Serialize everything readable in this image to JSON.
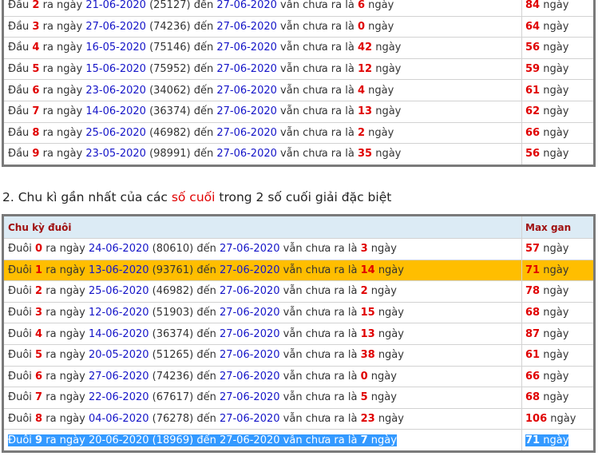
{
  "colors": {
    "date_blue": "#1515c8",
    "number_red": "#e00000",
    "highlight_row": "#ffbe00",
    "selection": "#3399ff",
    "header_bg": "#dcebf5"
  },
  "top_table": {
    "rows": [
      {
        "label": "Đầu",
        "digit": "2",
        "ra_ngay": "ra ngày",
        "date1": "21-06-2020",
        "code": "(25127)",
        "den": "đến",
        "date2": "27-06-2020",
        "mid": "vẫn chưa ra là",
        "count": "6",
        "unit": "ngày",
        "max": "84",
        "max_unit": "ngày"
      },
      {
        "label": "Đầu",
        "digit": "3",
        "ra_ngay": "ra ngày",
        "date1": "27-06-2020",
        "code": "(74236)",
        "den": "đến",
        "date2": "27-06-2020",
        "mid": "vẫn chưa ra là",
        "count": "0",
        "unit": "ngày",
        "max": "64",
        "max_unit": "ngày"
      },
      {
        "label": "Đầu",
        "digit": "4",
        "ra_ngay": "ra ngày",
        "date1": "16-05-2020",
        "code": "(75146)",
        "den": "đến",
        "date2": "27-06-2020",
        "mid": "vẫn chưa ra là",
        "count": "42",
        "unit": "ngày",
        "max": "56",
        "max_unit": "ngày"
      },
      {
        "label": "Đầu",
        "digit": "5",
        "ra_ngay": "ra ngày",
        "date1": "15-06-2020",
        "code": "(75952)",
        "den": "đến",
        "date2": "27-06-2020",
        "mid": "vẫn chưa ra là",
        "count": "12",
        "unit": "ngày",
        "max": "59",
        "max_unit": "ngày"
      },
      {
        "label": "Đầu",
        "digit": "6",
        "ra_ngay": "ra ngày",
        "date1": "23-06-2020",
        "code": "(34062)",
        "den": "đến",
        "date2": "27-06-2020",
        "mid": "vẫn chưa ra là",
        "count": "4",
        "unit": "ngày",
        "max": "61",
        "max_unit": "ngày"
      },
      {
        "label": "Đầu",
        "digit": "7",
        "ra_ngay": "ra ngày",
        "date1": "14-06-2020",
        "code": "(36374)",
        "den": "đến",
        "date2": "27-06-2020",
        "mid": "vẫn chưa ra là",
        "count": "13",
        "unit": "ngày",
        "max": "62",
        "max_unit": "ngày"
      },
      {
        "label": "Đầu",
        "digit": "8",
        "ra_ngay": "ra ngày",
        "date1": "25-06-2020",
        "code": "(46982)",
        "den": "đến",
        "date2": "27-06-2020",
        "mid": "vẫn chưa ra là",
        "count": "2",
        "unit": "ngày",
        "max": "66",
        "max_unit": "ngày"
      },
      {
        "label": "Đầu",
        "digit": "9",
        "ra_ngay": "ra ngày",
        "date1": "23-05-2020",
        "code": "(98991)",
        "den": "đến",
        "date2": "27-06-2020",
        "mid": "vẫn chưa ra là",
        "count": "35",
        "unit": "ngày",
        "max": "56",
        "max_unit": "ngày"
      }
    ]
  },
  "section2": {
    "heading_pre": "2. Chu kì gần nhất của các",
    "heading_accent": "số cuối",
    "heading_post": "trong 2 số cuối giải đặc biệt"
  },
  "bottom_table": {
    "header_col1": "Chu kỳ đuôi",
    "header_col2": "Max gan",
    "rows": [
      {
        "label": "Đuôi",
        "digit": "0",
        "ra_ngay": "ra ngày",
        "date1": "24-06-2020",
        "code": "(80610)",
        "den": "đến",
        "date2": "27-06-2020",
        "mid": "vẫn chưa ra là",
        "count": "3",
        "unit": "ngày",
        "max": "57",
        "max_unit": "ngày"
      },
      {
        "label": "Đuôi",
        "digit": "1",
        "ra_ngay": "ra ngày",
        "date1": "13-06-2020",
        "code": "(93761)",
        "den": "đến",
        "date2": "27-06-2020",
        "mid": "vẫn chưa ra là",
        "count": "14",
        "unit": "ngày",
        "max": "71",
        "max_unit": "ngày"
      },
      {
        "label": "Đuôi",
        "digit": "2",
        "ra_ngay": "ra ngày",
        "date1": "25-06-2020",
        "code": "(46982)",
        "den": "đến",
        "date2": "27-06-2020",
        "mid": "vẫn chưa ra là",
        "count": "2",
        "unit": "ngày",
        "max": "78",
        "max_unit": "ngày"
      },
      {
        "label": "Đuôi",
        "digit": "3",
        "ra_ngay": "ra ngày",
        "date1": "12-06-2020",
        "code": "(51903)",
        "den": "đến",
        "date2": "27-06-2020",
        "mid": "vẫn chưa ra là",
        "count": "15",
        "unit": "ngày",
        "max": "68",
        "max_unit": "ngày"
      },
      {
        "label": "Đuôi",
        "digit": "4",
        "ra_ngay": "ra ngày",
        "date1": "14-06-2020",
        "code": "(36374)",
        "den": "đến",
        "date2": "27-06-2020",
        "mid": "vẫn chưa ra là",
        "count": "13",
        "unit": "ngày",
        "max": "87",
        "max_unit": "ngày"
      },
      {
        "label": "Đuôi",
        "digit": "5",
        "ra_ngay": "ra ngày",
        "date1": "20-05-2020",
        "code": "(51265)",
        "den": "đến",
        "date2": "27-06-2020",
        "mid": "vẫn chưa ra là",
        "count": "38",
        "unit": "ngày",
        "max": "61",
        "max_unit": "ngày"
      },
      {
        "label": "Đuôi",
        "digit": "6",
        "ra_ngay": "ra ngày",
        "date1": "27-06-2020",
        "code": "(74236)",
        "den": "đến",
        "date2": "27-06-2020",
        "mid": "vẫn chưa ra là",
        "count": "0",
        "unit": "ngày",
        "max": "66",
        "max_unit": "ngày"
      },
      {
        "label": "Đuôi",
        "digit": "7",
        "ra_ngay": "ra ngày",
        "date1": "22-06-2020",
        "code": "(67617)",
        "den": "đến",
        "date2": "27-06-2020",
        "mid": "vẫn chưa ra là",
        "count": "5",
        "unit": "ngày",
        "max": "68",
        "max_unit": "ngày"
      },
      {
        "label": "Đuôi",
        "digit": "8",
        "ra_ngay": "ra ngày",
        "date1": "04-06-2020",
        "code": "(76278)",
        "den": "đến",
        "date2": "27-06-2020",
        "mid": "vẫn chưa ra là",
        "count": "23",
        "unit": "ngày",
        "max": "106",
        "max_unit": "ngày"
      },
      {
        "label": "Đuôi",
        "digit": "9",
        "ra_ngay": "ra ngày",
        "date1": "20-06-2020",
        "code": "(18969)",
        "den": "đến",
        "date2": "27-06-2020",
        "mid": "vẫn chưa ra là",
        "count": "7",
        "unit": "ngày",
        "max": "71",
        "max_unit": "ngày"
      }
    ]
  }
}
